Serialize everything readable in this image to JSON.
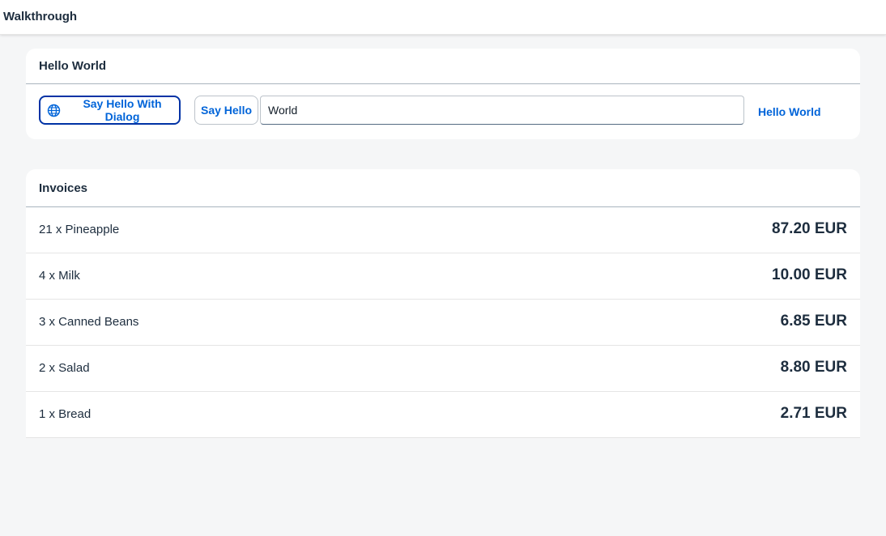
{
  "shell": {
    "title": "Walkthrough"
  },
  "hello_panel": {
    "title": "Hello World",
    "dialog_button_label": "Say Hello With Dialog",
    "dialog_button_icon": "globe-icon",
    "hello_button_label": "Say Hello",
    "input_value": "World",
    "output_text": "Hello World"
  },
  "invoices_panel": {
    "title": "Invoices",
    "items": [
      {
        "name": "21 x Pineapple",
        "price": "87.20 EUR"
      },
      {
        "name": "4 x Milk",
        "price": "10.00 EUR"
      },
      {
        "name": "3 x Canned Beans",
        "price": "6.85 EUR"
      },
      {
        "name": "2 x Salad",
        "price": "8.80 EUR"
      },
      {
        "name": "1 x Bread",
        "price": "2.71 EUR"
      }
    ]
  },
  "colors": {
    "accent": "#0064d9",
    "focus_border": "#0032a5",
    "page_background": "#f5f6f7",
    "text": "#1d2d3e"
  }
}
